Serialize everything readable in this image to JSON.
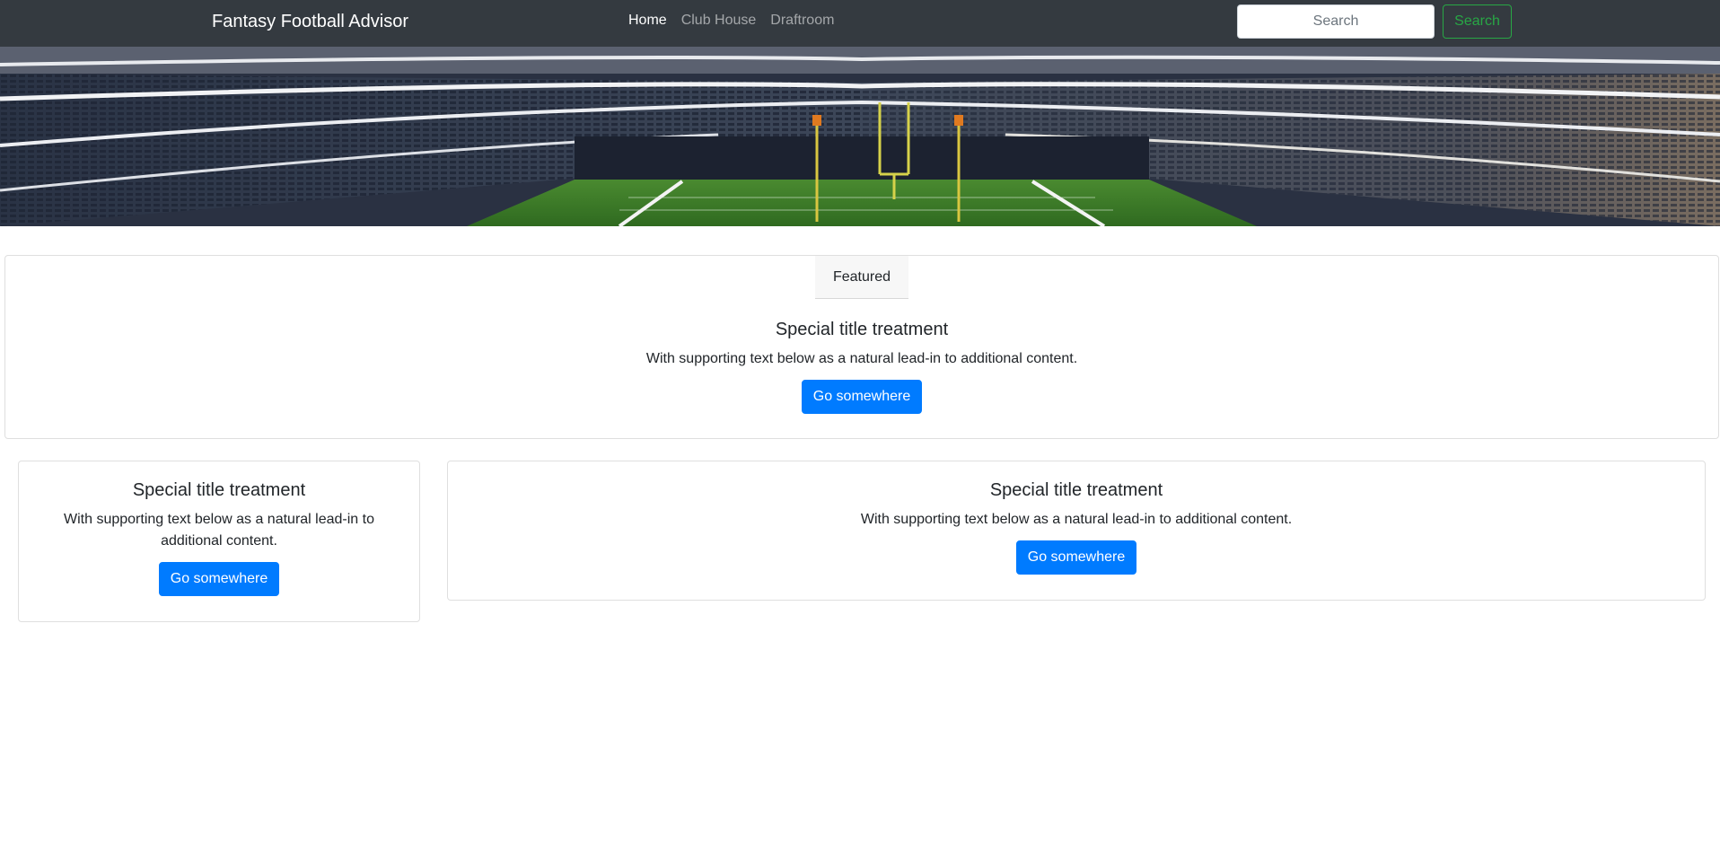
{
  "navbar": {
    "brand": "Fantasy Football Advisor",
    "links": [
      {
        "label": "Home",
        "active": true
      },
      {
        "label": "Club House",
        "active": false
      },
      {
        "label": "Draftroom",
        "active": false
      }
    ],
    "search": {
      "placeholder": "Search",
      "value": "",
      "button_label": "Search"
    }
  },
  "hero": {
    "image": "stadium-banner-image"
  },
  "cards": {
    "featured": {
      "header": "Featured",
      "title": "Special title treatment",
      "text": "With supporting text below as a natural lead-in to additional content.",
      "button_label": "Go somewhere"
    },
    "small": {
      "title": "Special title treatment",
      "text": "With supporting text below as a natural lead-in to additional content.",
      "button_label": "Go somewhere"
    },
    "wide": {
      "title": "Special title treatment",
      "text": "With supporting text below as a natural lead-in to additional content.",
      "button_label": "Go somewhere"
    }
  },
  "colors": {
    "navbar_bg": "#343a40",
    "primary": "#007bff",
    "success": "#28a745",
    "field_green": "#3f7d2a"
  }
}
